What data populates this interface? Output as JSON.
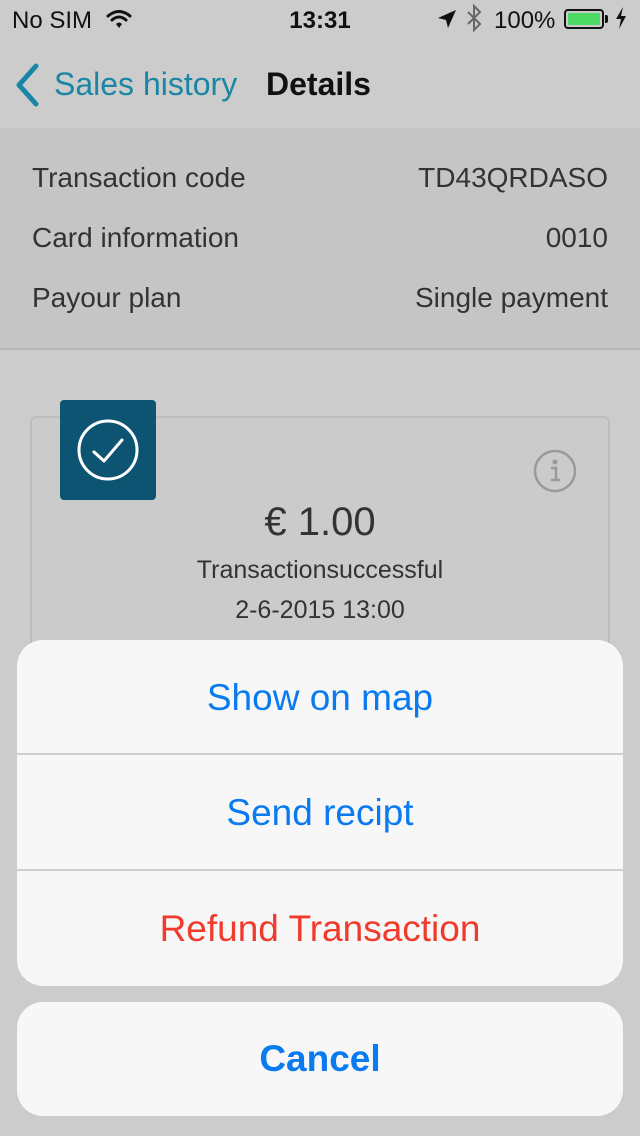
{
  "status_bar": {
    "carrier": "No SIM",
    "time": "13:31",
    "battery_percent": "100%",
    "battery_level": 1.0
  },
  "nav": {
    "back_label": "Sales history",
    "title": "Details"
  },
  "details": {
    "rows": [
      {
        "label": "Transaction code",
        "value": "TD43QRDASO"
      },
      {
        "label": "Card information",
        "value": "0010"
      },
      {
        "label": "Payour plan",
        "value": "Single payment"
      }
    ]
  },
  "transaction": {
    "amount": "€ 1.00",
    "status": "Transactionsuccessful",
    "date": "2-6-2015  13:00"
  },
  "action_sheet": {
    "items": [
      {
        "label": "Show on map"
      },
      {
        "label": "Send recipt"
      },
      {
        "label": "Refund Transaction"
      }
    ],
    "cancel_label": "Cancel"
  },
  "colors": {
    "accent_blue": "#0a7af0",
    "nav_blue": "#1a86a6",
    "destructive_red": "#f03a2c",
    "success_tile": "#0d5473",
    "battery_green": "#4cd964"
  },
  "icons": [
    "wifi-icon",
    "location-arrow-icon",
    "bluetooth-icon",
    "battery-icon",
    "charging-bolt-icon",
    "chevron-left-icon",
    "checkmark-circle-icon",
    "info-icon"
  ]
}
